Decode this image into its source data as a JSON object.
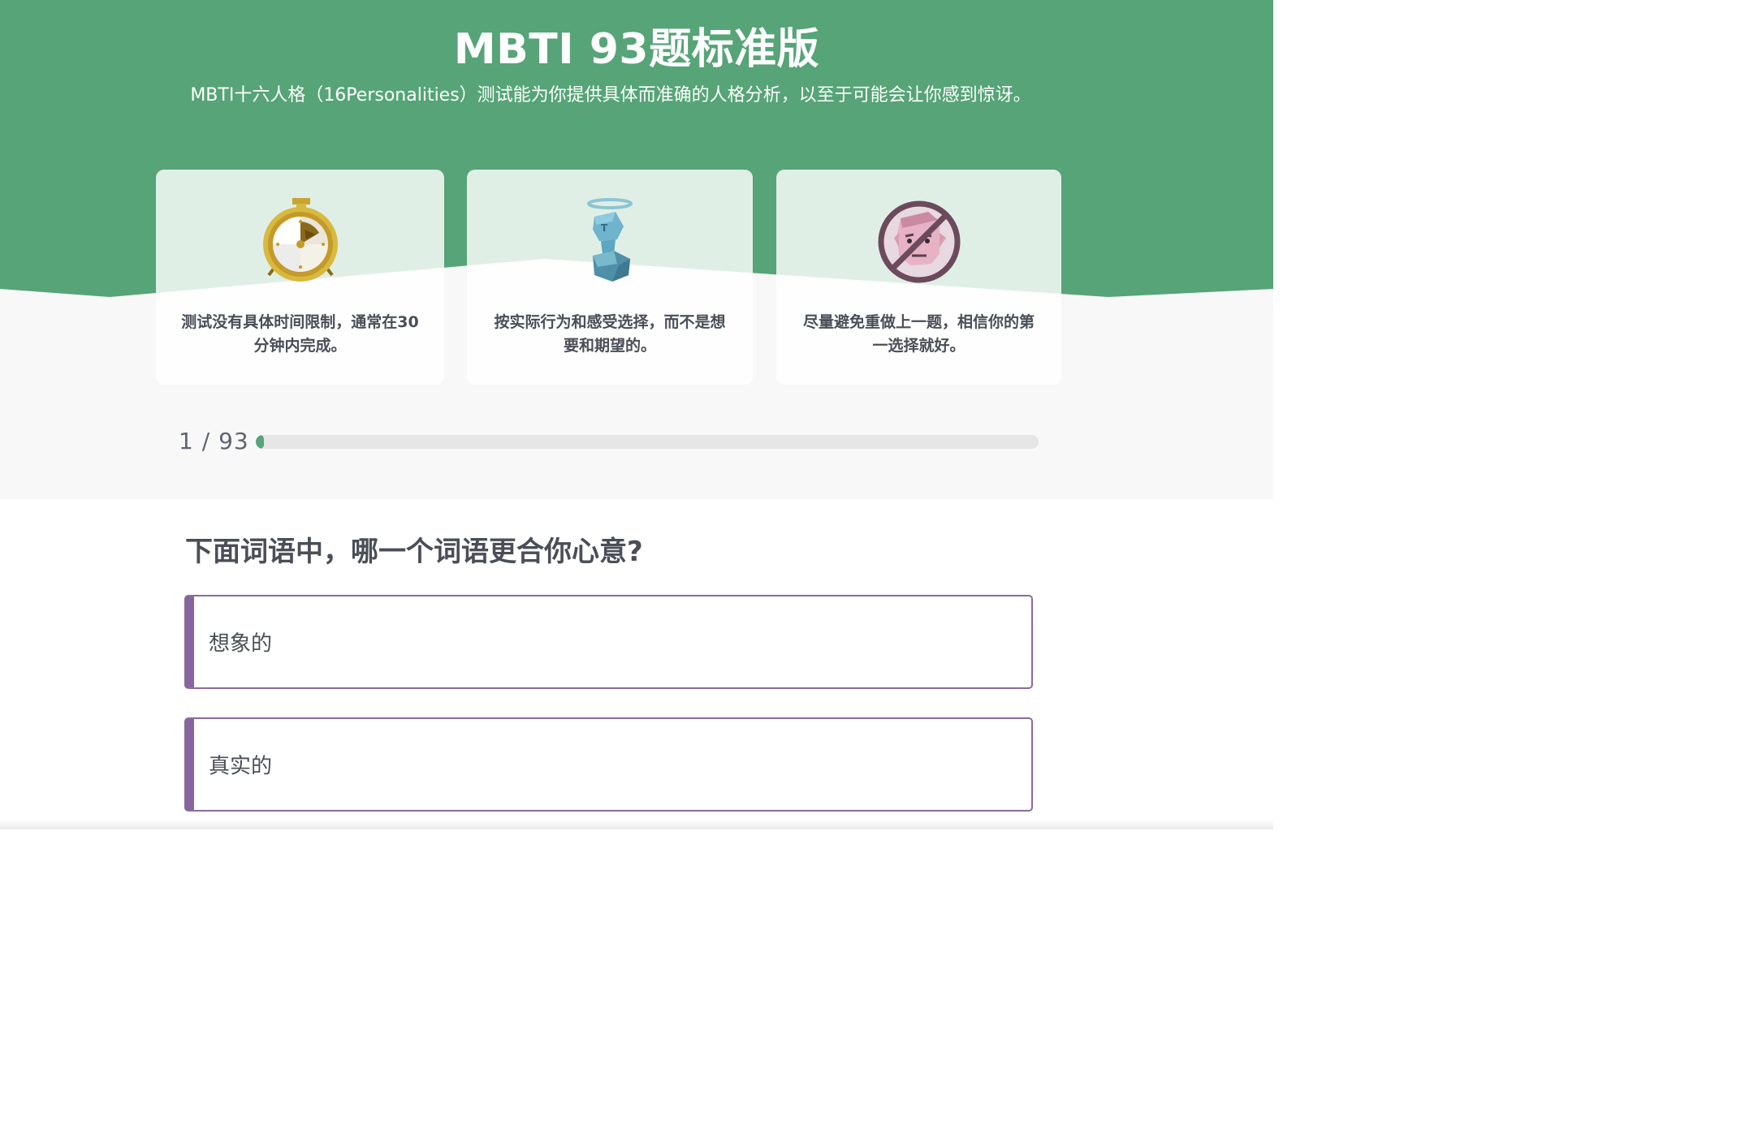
{
  "header": {
    "title": "MBTI 93题标准版",
    "subtitle": "MBTI十六人格（16Personalities）测试能为你提供具体而准确的人格分析，以至于可能会让你感到惊讶。"
  },
  "tips": [
    {
      "icon": "stopwatch-icon",
      "text": "测试没有具体时间限制，通常在30分钟内完成。"
    },
    {
      "icon": "honest-character-icon",
      "text": "按实际行为和感受选择，而不是想要和期望的。"
    },
    {
      "icon": "no-overthinking-icon",
      "text": "尽量避免重做上一题，相信你的第一选择就好。"
    }
  ],
  "progress": {
    "current": "1",
    "separator": "/",
    "total": "93",
    "fraction": 0.0108
  },
  "question": {
    "text": "下面词语中，哪一个词语更合你心意?",
    "options": [
      {
        "label": "想象的"
      },
      {
        "label": "真实的"
      }
    ]
  },
  "colors": {
    "brand_green": "#56a477",
    "option_purple": "#87659e",
    "text_dark": "#4a4e57"
  }
}
